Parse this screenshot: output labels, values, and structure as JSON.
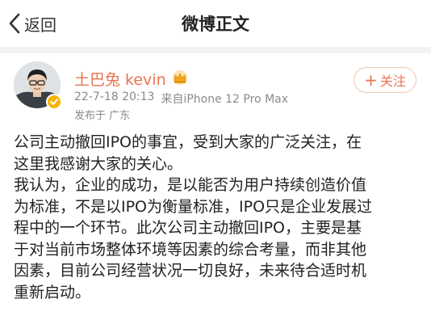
{
  "nav": {
    "back_label": "返回",
    "title": "微博正文"
  },
  "author": {
    "name": "土巴兔 kevin",
    "date": "22-7-18 20:13",
    "source": "来自iPhone 12 Pro Max",
    "location": "发布于 广东"
  },
  "follow": {
    "label": "关注"
  },
  "post": {
    "lines": [
      "公司主动撤回IPO的事宜，受到大家的广泛关注，在",
      "这里我感谢大家的关心。",
      "我认为，企业的成功，是以能否为用户持续创造价值",
      "为标准，不是以IPO为衡量标准，IPO只是企业发展过",
      "程中的一个环节。此次公司主动撤回IPO，主要是基",
      "于对当前市场整体环境等因素的综合考量，而非其他",
      "因素，目前公司经营状况一切良好，未来待合适时机",
      "重新启动。"
    ]
  },
  "icons": {
    "back": "chevron-left-icon",
    "verify": "verified-badge-icon",
    "member": "crown-icon"
  },
  "colors": {
    "username": "#eb7350",
    "follow": "#eb7350",
    "meta": "#8a8a8a"
  }
}
